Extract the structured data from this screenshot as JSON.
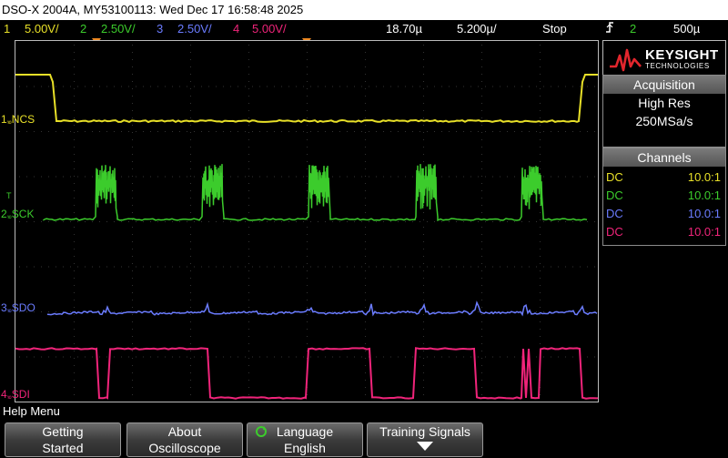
{
  "title": "DSO-X 2004A, MY53100113: Wed Dec 17 16:58:48 2025",
  "status": {
    "ch1": {
      "num": "1",
      "scale": "5.00V/",
      "color": "#e8e028"
    },
    "ch2": {
      "num": "2",
      "scale": "2.50V/",
      "color": "#3ccc2c"
    },
    "ch3": {
      "num": "3",
      "scale": "2.50V/",
      "color": "#6b7cff"
    },
    "ch4": {
      "num": "4",
      "scale": "5.00V/",
      "color": "#f0247a"
    },
    "delay": "18.70µ",
    "timebase": "5.200µ/",
    "run_state": "Stop",
    "trigger_icon": "trigger-edge-icon",
    "trigger_source": "2",
    "trigger_level": "500µ"
  },
  "channels_on_screen": [
    {
      "name": "NCS",
      "num": "1"
    },
    {
      "name": "SCK",
      "num": "2"
    },
    {
      "name": "SDO",
      "num": "3"
    },
    {
      "name": "SDI",
      "num": "4"
    }
  ],
  "trigger_marker": "T",
  "brand": {
    "name": "KEYSIGHT",
    "sub": "TECHNOLOGIES",
    "logo_icon": "keysight-wave-icon"
  },
  "acquisition": {
    "header": "Acquisition",
    "mode": "High Res",
    "rate": "250MSa/s"
  },
  "channels_panel": {
    "header": "Channels",
    "rows": [
      {
        "coupling": "DC",
        "probe": "10.0:1"
      },
      {
        "coupling": "DC",
        "probe": "10.0:1"
      },
      {
        "coupling": "DC",
        "probe": "10.0:1"
      },
      {
        "coupling": "DC",
        "probe": "10.0:1"
      }
    ]
  },
  "menu_title": "Help Menu",
  "softkeys": [
    {
      "l1": "Getting",
      "l2": "Started"
    },
    {
      "l1": "About",
      "l2": "Oscilloscope"
    },
    {
      "l1": "Language",
      "l2": "English",
      "icon": "language-cycle-icon"
    },
    {
      "l1": "Training Signals",
      "icon": "down-arrow-icon"
    }
  ]
}
